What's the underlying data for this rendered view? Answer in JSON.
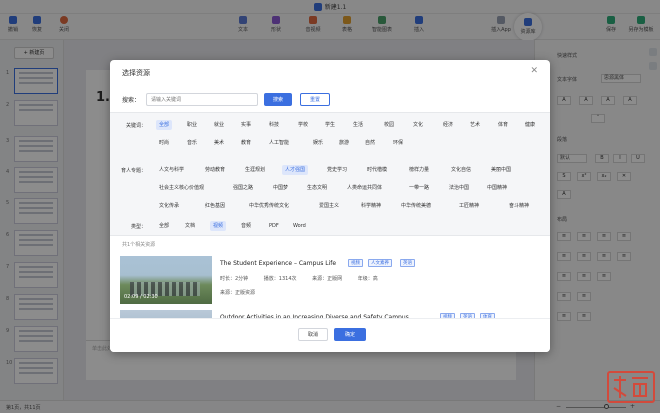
{
  "window": {
    "title": "新建1.1"
  },
  "toolbar": {
    "left": [
      {
        "label": "撤销",
        "icon": "undo-icon"
      },
      {
        "label": "恢复",
        "icon": "redo-icon"
      },
      {
        "label": "关闭",
        "icon": "close-circle-icon"
      }
    ],
    "center": [
      {
        "label": "文本",
        "icon": "text-icon",
        "color": "#5b7bd5"
      },
      {
        "label": "形状",
        "icon": "shape-icon",
        "color": "#8c59d6"
      },
      {
        "label": "音视频",
        "icon": "media-icon",
        "color": "#e06b40"
      },
      {
        "label": "表格",
        "icon": "table-icon",
        "color": "#e2a030"
      },
      {
        "label": "智能图表",
        "icon": "chart-icon",
        "color": "#4aa06a"
      },
      {
        "label": "插入",
        "icon": "insert-icon",
        "color": "#3b6fe0"
      }
    ],
    "right": [
      {
        "label": "插入App",
        "icon": "app-icon"
      },
      {
        "label": "资源库",
        "icon": "library-icon",
        "active": true
      },
      {
        "label": "保存",
        "icon": "save-icon"
      },
      {
        "label": "另存为模板",
        "icon": "save-template-icon"
      }
    ]
  },
  "left_panel": {
    "new_slide_label": "+ 新建页",
    "slide_numbers": [
      "1",
      "2",
      "3",
      "4",
      "5",
      "6",
      "7",
      "8",
      "9",
      "10",
      "11"
    ]
  },
  "canvas": {
    "slide_number": "1.",
    "notes_placeholder": "单击此处添加备注"
  },
  "right_panel": {
    "section_title": "快速样式",
    "font_label": "文本字体",
    "font_value": "思源黑体",
    "para_label": "段落",
    "size_value": "默认",
    "layout_label": "布局"
  },
  "dialog": {
    "title": "选择资源",
    "search_label": "搜索：",
    "search_placeholder": "请输入关键词",
    "search_button": "搜索",
    "reset_button": "重置",
    "filters": {
      "keyword_label": "关键词：",
      "keyword_row1": [
        "全部",
        "职业",
        "就业",
        "实事",
        "科技",
        "学校",
        "学生",
        "生活",
        "校园",
        "文化",
        "经济",
        "艺术",
        "体育",
        "健康"
      ],
      "keyword_row2": [
        "时尚",
        "音乐",
        "美术",
        "教育",
        "人工智能",
        "娱乐",
        "旅游",
        "自然",
        "环保"
      ],
      "topic_label": "育人专题：",
      "topic_row1": [
        "人文与科学",
        "劳动教育",
        "生涯规划",
        "人才强国",
        "党史学习",
        "时代楷模",
        "榜样力量",
        "文化自信",
        "美丽中国"
      ],
      "topic_row2": [
        "社会主义核心价值观",
        "强国之路",
        "中国梦",
        "生态文明",
        "人类命运共同体",
        "一带一路",
        "法治中国",
        "中国精神"
      ],
      "topic_row3": [
        "文化传承",
        "红色基因",
        "中华优秀传统文化",
        "爱国主义",
        "科学精神",
        "中华传统美德",
        "工匠精神",
        "奋斗精神"
      ],
      "type_label": "类型：",
      "type_row": [
        "全部",
        "文档",
        "视频",
        "音频",
        "PDF",
        "Word"
      ]
    },
    "result_hint": "共1个相关资源",
    "results": [
      {
        "title": "The Student Experience – Campus Life",
        "tags": [
          "视频",
          "人文素养",
          "英语"
        ],
        "duration_label": "时长：2分钟",
        "views_label": "播放：1314次",
        "source_label": "来源：正版网",
        "grade_label": "年级：高",
        "provider": "来源：正版资源",
        "thumb_duration": "02:09 / 02:30"
      },
      {
        "title": "Outdoor Activities in an Increasing Diverse and Safety Campus",
        "tags": [
          "视频",
          "英语",
          "体育"
        ]
      }
    ],
    "cancel_button": "取消",
    "ok_button": "确定"
  },
  "status_bar": {
    "slide_info": "第1页，共11页",
    "zoom_label": "100%"
  },
  "colors": {
    "accent": "#3b6fe0",
    "overlay": "rgba(0,0,0,0.45)",
    "watermark": "#d24a3c"
  }
}
